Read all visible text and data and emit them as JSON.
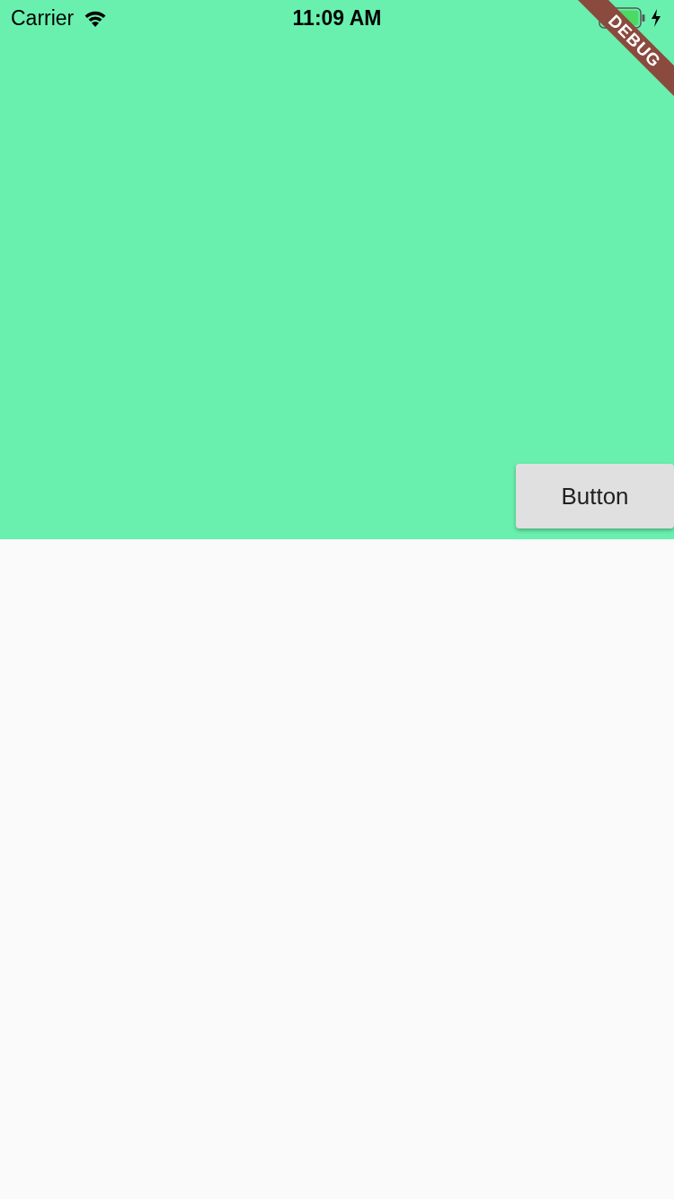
{
  "status_bar": {
    "carrier": "Carrier",
    "time": "11:09 AM"
  },
  "debug_banner": {
    "label": "DEBUG"
  },
  "button": {
    "label": "Button"
  }
}
